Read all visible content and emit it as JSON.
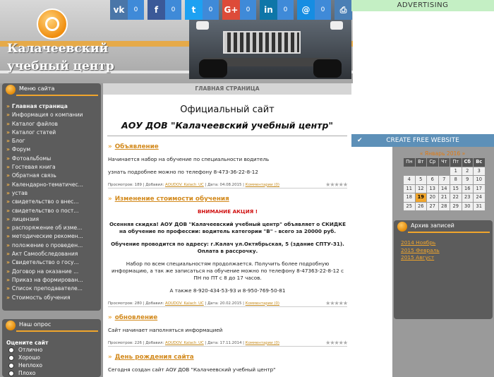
{
  "header": {
    "title_line1": "Калачеевский",
    "title_line2": "учебный центр"
  },
  "social": [
    {
      "name": "vk",
      "label": "vk",
      "count": "0",
      "color": "#4a76a8"
    },
    {
      "name": "facebook",
      "label": "f",
      "count": "0",
      "color": "#3b5998"
    },
    {
      "name": "twitter",
      "label": "t",
      "count": "0",
      "color": "#1da1f2"
    },
    {
      "name": "google-plus",
      "label": "G+",
      "count": "0",
      "color": "#dd4b39"
    },
    {
      "name": "linkedin",
      "label": "in",
      "count": "0",
      "color": "#0e76a8"
    },
    {
      "name": "moimir",
      "label": "@",
      "count": "0",
      "color": "#168de2"
    },
    {
      "name": "print",
      "label": "⎙",
      "count": "",
      "color": "#4a7fb5"
    }
  ],
  "ads": {
    "advertising": "ADVERTISING",
    "create_site": "CREATE FREE WEBSITE"
  },
  "menu": {
    "title": "Меню сайта",
    "items": [
      "Главная страница",
      "Информация о компании",
      "Каталог файлов",
      "Каталог статей",
      "Блог",
      "Форум",
      "Фотоальбомы",
      "Гостевая книга",
      "Обратная связь",
      "Календарно-тематичес...",
      "устав",
      "свидетельство о внес...",
      "свидетельство о пост...",
      "лицензия",
      "распоряжение об изме...",
      "методические рекомен...",
      "положение о проведен...",
      "Акт Самообследования",
      "Свидетельство о госу...",
      "Договор на оказание ...",
      "Приказ на формирован...",
      "Список преподавателе...",
      "Стоимость обучения"
    ]
  },
  "poll": {
    "title": "Наш опрос",
    "question": "Оцените сайт",
    "options": [
      "Отлично",
      "Хорошо",
      "Неплохо",
      "Плохо"
    ]
  },
  "main": {
    "breadcrumb": "ГЛАВНАЯ СТРАНИЦА",
    "title": "Официальный сайт",
    "subtitle": "АОУ ДОВ \"Калачеевский учебный центр\"",
    "posts": [
      {
        "title": "Объявление",
        "lines": [
          "Начинается набор на обучение по специальности водитель",
          "узнать подробнее можно по телефону 8-473-36-22-8-12"
        ],
        "meta_views": "Просмотров: 189 | Добавил:",
        "meta_author": "AOUDOV_Kalach_UC",
        "meta_date": "| Дата: 04.08.2015 |",
        "meta_comments": "Комментарии (0)"
      },
      {
        "title": "Изменение стоимости обучения",
        "notice": "ВНИМАНИЕ АКЦИЯ !",
        "discount_line": "Осенняя скидка! АОУ ДОВ \"Калачеевский учебный центр\" объявляет о СКИДКЕ на обучение по профессии: водитель категории \"В\"  -  всего за  20000 руб.",
        "address_line": "Обучение проводится по адресу: г.Калач ул.Октябрьская, 5 (здание СПТУ-31). Оплата в рассрочку.",
        "info_line": "Набор по всем специальностям продолжается.  Получить более подробную информацию, а так же записаться на обучение можно по телефону 8-47363-22-8-12 с ПН по ПТ с 8 до 17 часов.",
        "phones_line": "А также 8-920-434-53-93 и 8-950-769-50-81",
        "meta_views": "Просмотров: 280 | Добавил:",
        "meta_author": "AOUDOV_Kalach_UC",
        "meta_date": "| Дата: 20.02.2015 |",
        "meta_comments": "Комментарии (0)"
      },
      {
        "title": "обновление",
        "lines": [
          "Сайт начинает наполняться информацией"
        ],
        "meta_views": "Просмотров: 226 | Добавил:",
        "meta_author": "AOUDOV_Kalach_UC",
        "meta_date": "| Дата: 17.11.2014 |",
        "meta_comments": "Комментарии (0)"
      },
      {
        "title": "День рождения сайта",
        "lines": [
          "Сегодня создан сайт АОУ ДОВ \"Калачеевский учебный центр\""
        ]
      }
    ]
  },
  "calendar": {
    "title": "« Январь 2016 »",
    "weekdays": [
      "Пн",
      "Вт",
      "Ср",
      "Чт",
      "Пт",
      "Сб",
      "Вс"
    ],
    "days": [
      "",
      "",
      "",
      "",
      "1",
      "2",
      "3",
      "4",
      "5",
      "6",
      "7",
      "8",
      "9",
      "10",
      "11",
      "12",
      "13",
      "14",
      "15",
      "16",
      "17",
      "18",
      "19",
      "20",
      "21",
      "22",
      "23",
      "24",
      "25",
      "26",
      "27",
      "28",
      "29",
      "30",
      "31"
    ],
    "today": "19"
  },
  "archive": {
    "title": "Архив записей",
    "items": [
      "2014 Ноябрь",
      "2015 Февраль",
      "2015 Август"
    ]
  }
}
